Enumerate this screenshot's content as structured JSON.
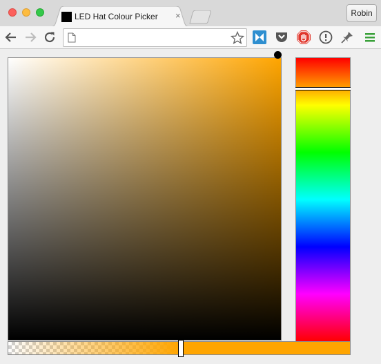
{
  "window": {
    "controls": [
      "close",
      "minimize",
      "maximize"
    ],
    "profile_label": "Robin"
  },
  "tab": {
    "title": "LED Hat Colour Picker",
    "close_glyph": "×",
    "favicon_color": "#000000"
  },
  "toolbar": {
    "back_icon": "back-arrow-icon",
    "forward_icon": "forward-arrow-icon",
    "reload_icon": "reload-icon",
    "address_value": "",
    "address_placeholder": "",
    "extensions": [
      "blue-butterfly-extension-icon",
      "pocket-icon",
      "stop-hand-icon",
      "info-circle-icon",
      "pin-icon",
      "menu-icon"
    ]
  },
  "picker": {
    "selected_hue_color": "#ffa500",
    "saturation": 1.0,
    "value": 1.0,
    "hue_position": 0.11,
    "alpha": 0.5
  }
}
